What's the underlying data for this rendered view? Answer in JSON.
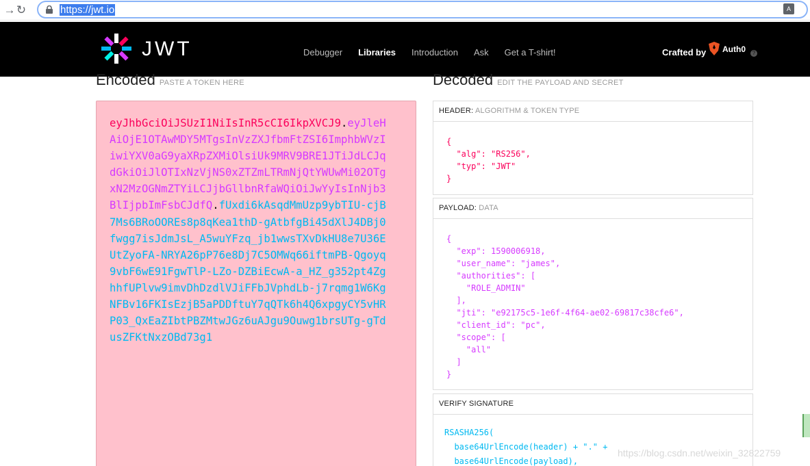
{
  "browser": {
    "url": "https://jwt.io"
  },
  "header": {
    "logo_text": "JWT",
    "nav": [
      {
        "label": "Debugger"
      },
      {
        "label": "Libraries"
      },
      {
        "label": "Introduction"
      },
      {
        "label": "Ask"
      },
      {
        "label": "Get a T-shirt!"
      }
    ],
    "crafted_by": "Crafted by",
    "brand": "Auth0"
  },
  "encoded": {
    "title": "Encoded",
    "subtitle": "PASTE A TOKEN HERE",
    "token_header": "eyJhbGciOiJSUzI1NiIsInR5cCI6IkpXVCJ9",
    "token_payload": "eyJleHAiOjE1OTAwMDY5MTgsInVzZXJfbmFtZSI6ImphbWVzIiwiYXV0aG9yaXRpZXMiOlsiUk9MRV9BRE1JTiJdLCJqdGkiOiJlOTIxNzVjNS0xZTZmLTRmNjQtYWUwMi02OTgxN2MzOGNmZTYiLCJjbGllbnRfaWQiOiJwYyIsInNjb3BlIjpbImFsbCJdfQ",
    "token_signature": "fUxdi6kAsqdMmUzp9ybTIU-cjB7Ms6BRoOOREs8p8qKea1thD-gAtbfgBi45dXlJ4DBj0fwgg7isJdmJsL_A5wuYFzq_jb1wwsTXvDkHU8e7U36EUtZyoFA-NRYA26pP76e8Dj7C5OMWq66iftmPB-Qgoyq9vbF6wE91FgwTlP-LZo-DZBiEcwA-a_HZ_g352pt4ZghhfUPlvw9imvDhDzdlVJiFFbJVphdLb-j7rqmg1W6KgNFBv16FKIsEzjB5aPDDftuY7qQTk6h4Q6xpgyCY5vHRP03_QxEaZIbtPBZMtwJGz6uAJgu9Ouwg1brsUTg-gTdusZFKtNxzOBd73g1",
    "dot": "."
  },
  "decoded": {
    "title": "Decoded",
    "subtitle": "EDIT THE PAYLOAD AND SECRET",
    "header_label": "HEADER:",
    "header_sub": "ALGORITHM & TOKEN TYPE",
    "header_json": {
      "alg": "RS256",
      "typ": "JWT"
    },
    "payload_label": "PAYLOAD:",
    "payload_sub": "DATA",
    "payload_json": {
      "exp": "1590006918",
      "user_name": "james",
      "authorities": [
        "ROLE_ADMIN"
      ],
      "jti": "e92175c5-1e6f-4f64-ae02-69817c38cfe6",
      "client_id": "pc",
      "scope": [
        "all"
      ]
    },
    "verify_label": "VERIFY SIGNATURE",
    "verify_lines": [
      "RSASHA256(",
      "  base64UrlEncode(header) + \".\" +",
      "  base64UrlEncode(payload),"
    ]
  },
  "watermark": "https://blog.csdn.net/weixin_32822759",
  "colors": {
    "header_token": "#fb015b",
    "payload_token": "#d63aff",
    "signature_token": "#00b9f1",
    "encoded_bg": "#ffc1cc"
  }
}
